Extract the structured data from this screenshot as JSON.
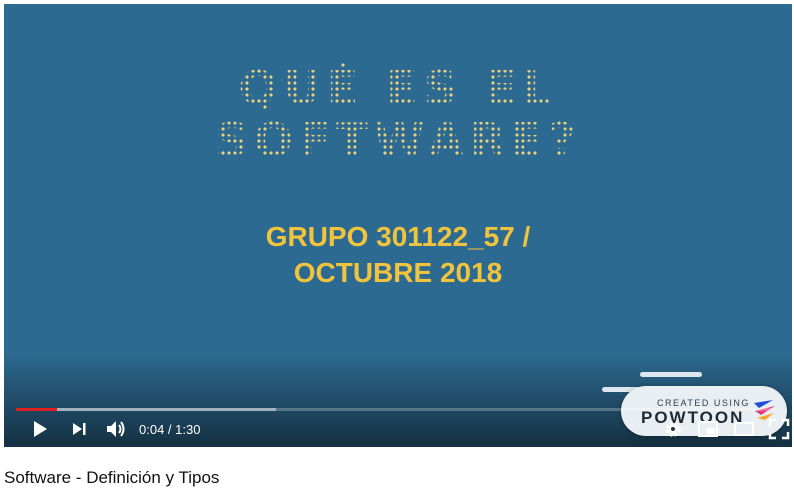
{
  "video": {
    "title_line1": "QUÉ ES EL",
    "title_line2": "SOFTWARE?",
    "subtitle_line1": "GRUPO 301122_57 /",
    "subtitle_line2": "OCTUBRE 2018",
    "background_color": "#2d6a91",
    "accent_color": "#f2c33c"
  },
  "badge": {
    "created_label": "CREATED USING",
    "brand_name": "POWTOON"
  },
  "player": {
    "current_time": "0:04",
    "separator": " / ",
    "duration": "1:30",
    "progress_fraction": 0.054,
    "buffered_fraction": 0.34,
    "progress_color": "#e02020",
    "icons": {
      "play": "play-icon",
      "next": "next-icon",
      "volume": "volume-icon",
      "settings": "gear-icon",
      "miniplayer": "miniplayer-icon",
      "theater": "theater-icon",
      "fullscreen": "fullscreen-icon"
    }
  },
  "page": {
    "video_title": "Software - Definición y Tipos"
  }
}
